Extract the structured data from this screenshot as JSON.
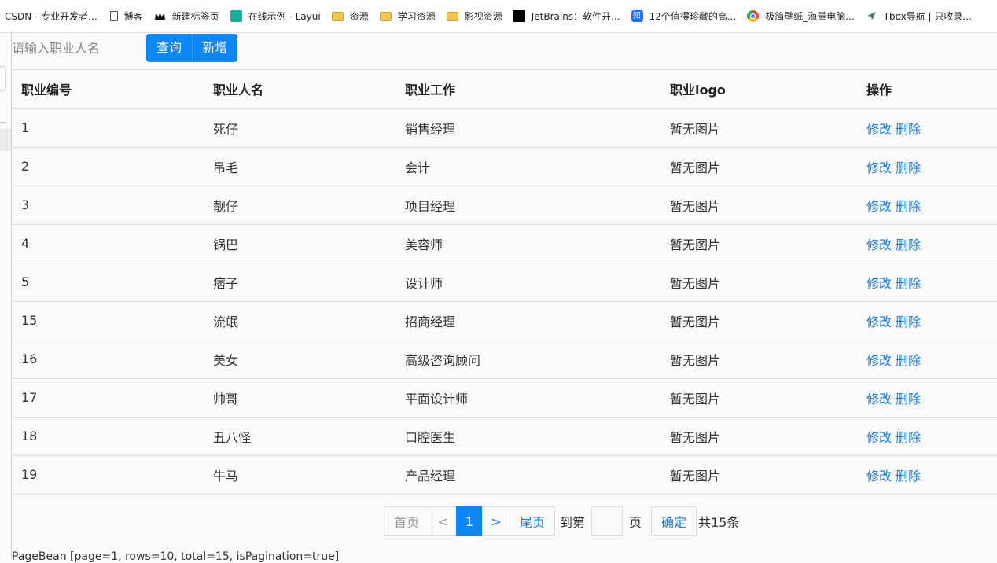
{
  "bookmarks": [
    {
      "label": "CSDN - 专业开发者...",
      "icon": "none"
    },
    {
      "label": "博客",
      "icon": "page-icon"
    },
    {
      "label": "新建标签页",
      "icon": "crown-icon"
    },
    {
      "label": "在线示例 - Layui",
      "icon": "layui-icon"
    },
    {
      "label": "资源",
      "icon": "folder-icon"
    },
    {
      "label": "学习资源",
      "icon": "folder-icon"
    },
    {
      "label": "影视资源",
      "icon": "folder-icon"
    },
    {
      "label": "JetBrains：软件开...",
      "icon": "jetbrains-icon"
    },
    {
      "label": "12个值得珍藏的高...",
      "icon": "zhihu-icon"
    },
    {
      "label": "极简壁纸_海量电脑...",
      "icon": "chrome-icon"
    },
    {
      "label": "Tbox导航 | 只收录...",
      "icon": "navigation-icon"
    }
  ],
  "search": {
    "placeholder": "请输入职业人名",
    "query_label": "查询",
    "add_label": "新增"
  },
  "table": {
    "headers": [
      "职业编号",
      "职业人名",
      "职业工作",
      "职业logo",
      "操作"
    ],
    "rows": [
      {
        "id": "1",
        "name": "死仔",
        "job": "销售经理",
        "logo": "暂无图片"
      },
      {
        "id": "2",
        "name": "吊毛",
        "job": "会计",
        "logo": "暂无图片"
      },
      {
        "id": "3",
        "name": "靓仔",
        "job": "项目经理",
        "logo": "暂无图片"
      },
      {
        "id": "4",
        "name": "锅巴",
        "job": "美容师",
        "logo": "暂无图片"
      },
      {
        "id": "5",
        "name": "痞子",
        "job": "设计师",
        "logo": "暂无图片"
      },
      {
        "id": "15",
        "name": "流氓",
        "job": "招商经理",
        "logo": "暂无图片"
      },
      {
        "id": "16",
        "name": "美女",
        "job": "高级咨询顾问",
        "logo": "暂无图片"
      },
      {
        "id": "17",
        "name": "帅哥",
        "job": "平面设计师",
        "logo": "暂无图片"
      },
      {
        "id": "18",
        "name": "丑八怪",
        "job": "口腔医生",
        "logo": "暂无图片"
      },
      {
        "id": "19",
        "name": "牛马",
        "job": "产品经理",
        "logo": "暂无图片"
      }
    ],
    "edit_label": "修改",
    "delete_label": "删除"
  },
  "pagination": {
    "first_label": "首页",
    "prev_label": "<",
    "current_page": "1",
    "next_label": ">",
    "last_label": "尾页",
    "goto_label": "到第",
    "page_unit": "页",
    "confirm_label": "确定",
    "total_text": "共15条"
  },
  "debug_text": "PageBean [page=1, rows=10, total=15, isPagination=true]",
  "colors": {
    "primary": "#0d86f7",
    "link": "#1a7fe0"
  }
}
